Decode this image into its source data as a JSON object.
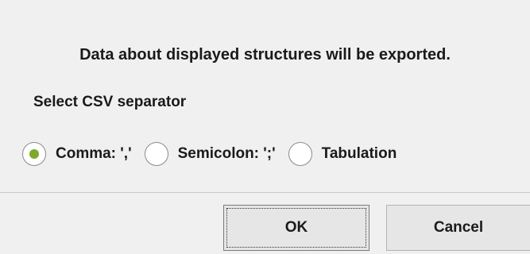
{
  "dialog": {
    "info_text": "Data about displayed structures will be exported.",
    "prompt_text": "Select CSV separator",
    "separator_options": [
      {
        "label": "Comma: ','",
        "selected": true
      },
      {
        "label": "Semicolon: ';'",
        "selected": false
      },
      {
        "label": "Tabulation",
        "selected": false
      }
    ],
    "buttons": {
      "ok_label": "OK",
      "cancel_label": "Cancel"
    }
  },
  "colors": {
    "radio_selected": "#7ea828",
    "background": "#f0f0f0"
  }
}
